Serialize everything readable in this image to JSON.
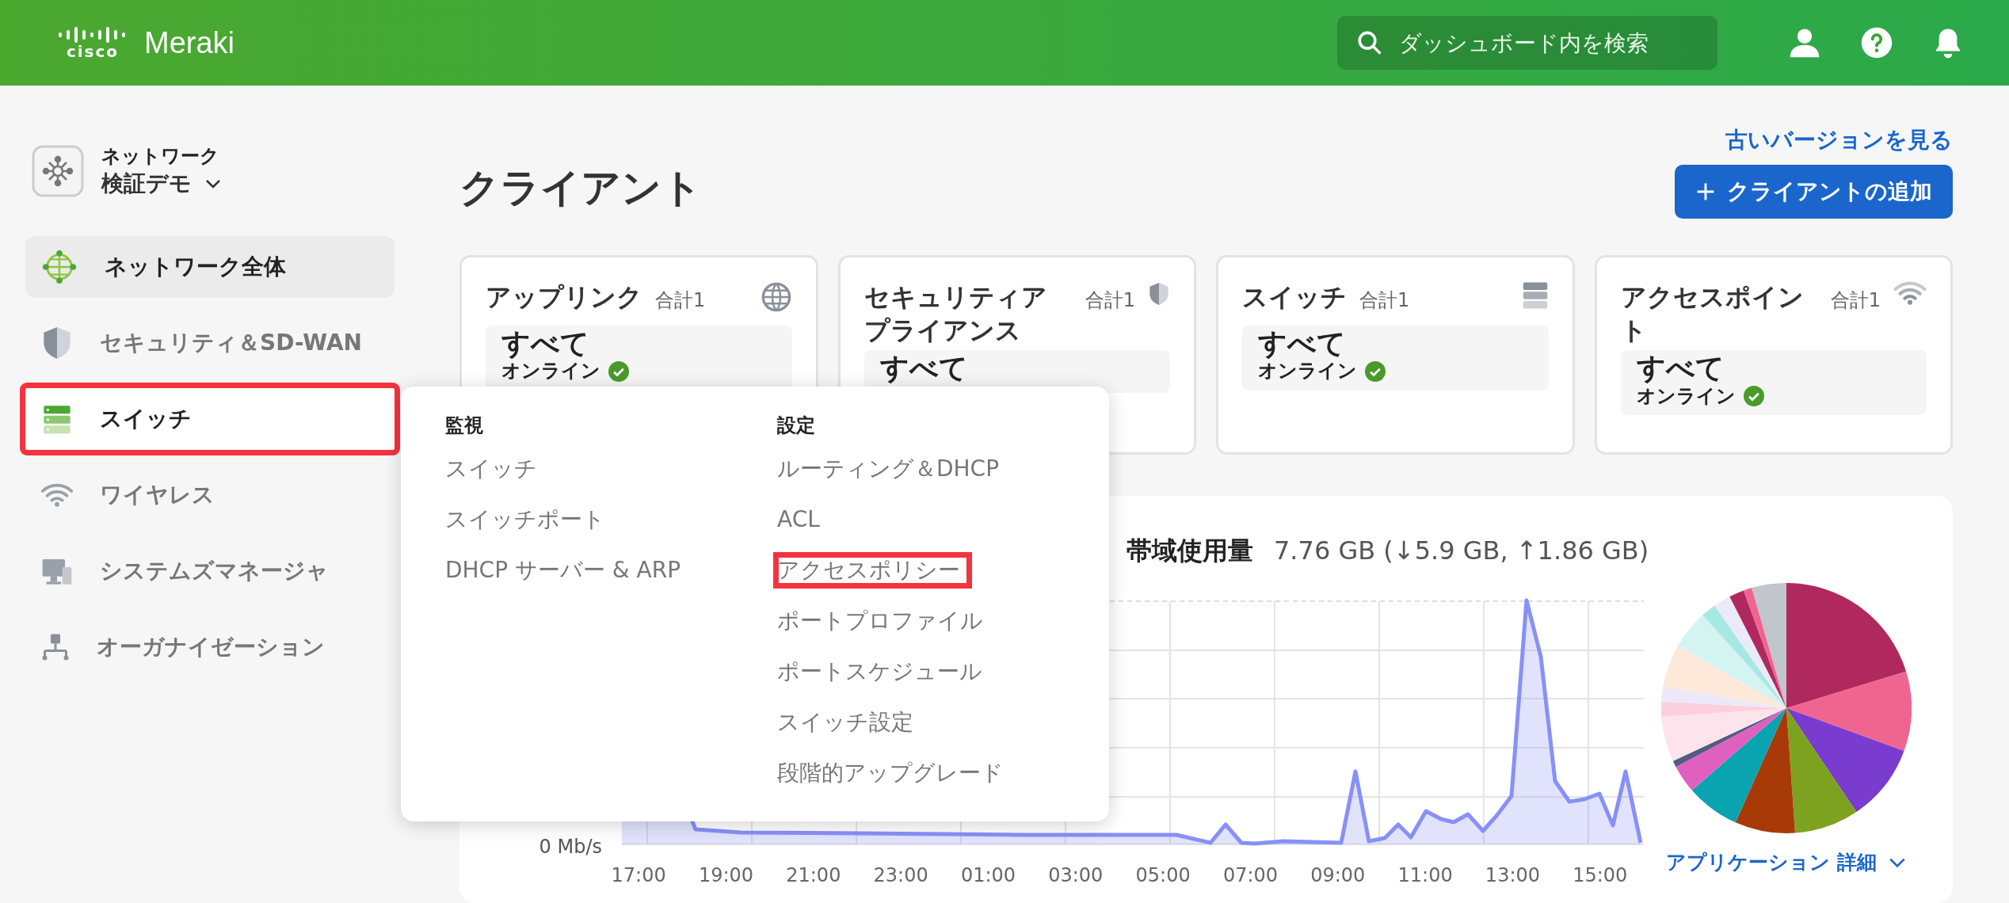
{
  "header": {
    "logo_text": "cisco",
    "product": "Meraki",
    "search": {
      "placeholder": "ダッシュボード内を検索"
    }
  },
  "sidebar": {
    "network": {
      "label": "ネットワーク",
      "name": "検証デモ"
    },
    "items": [
      {
        "label": "ネットワーク全体",
        "kind": "globe",
        "selected": true,
        "highlighted": false
      },
      {
        "label": "セキュリティ＆SD-WAN",
        "kind": "shield",
        "selected": false,
        "highlighted": false
      },
      {
        "label": "スイッチ",
        "kind": "switch",
        "selected": false,
        "highlighted": true
      },
      {
        "label": "ワイヤレス",
        "kind": "wifi",
        "selected": false,
        "highlighted": false
      },
      {
        "label": "システムズマネージャ",
        "kind": "monitor",
        "selected": false,
        "highlighted": false
      },
      {
        "label": "オーガナイゼーション",
        "kind": "org",
        "selected": false,
        "highlighted": false
      }
    ]
  },
  "page": {
    "title": "クライアント",
    "old_version_link": "古いバージョンを見る",
    "add_button": "クライアントの追加"
  },
  "cards": [
    {
      "title": "アップリンク",
      "total": "合計1",
      "kind": "globe",
      "value": "すべて",
      "status": {
        "label": "オンライン",
        "online": true
      }
    },
    {
      "title": "セキュリティアプライアンス",
      "total": "合計1",
      "kind": "shield",
      "value": "すべて"
    },
    {
      "title": "スイッチ",
      "total": "合計1",
      "kind": "server",
      "value": "すべて",
      "status": {
        "label": "オンライン",
        "online": true
      }
    },
    {
      "title": "アクセスポイント",
      "total": "合計1",
      "kind": "wifi",
      "value": "すべて",
      "status": {
        "label": "オンライン",
        "online": true
      }
    }
  ],
  "menu": {
    "columns": [
      {
        "heading": "監視",
        "items": [
          {
            "label": "スイッチ",
            "highlighted": false
          },
          {
            "label": "スイッチポート",
            "highlighted": false
          },
          {
            "label": "DHCP サーバー & ARP",
            "highlighted": false
          }
        ]
      },
      {
        "heading": "設定",
        "items": [
          {
            "label": "ルーティング＆DHCP",
            "highlighted": false
          },
          {
            "label": "ACL",
            "highlighted": false
          },
          {
            "label": "アクセスポリシー",
            "highlighted": true
          },
          {
            "label": "ポートプロファイル",
            "highlighted": false
          },
          {
            "label": "ポートスケジュール",
            "highlighted": false
          },
          {
            "label": "スイッチ設定",
            "highlighted": false
          },
          {
            "label": "段階的アップグレード",
            "highlighted": false
          }
        ]
      }
    ]
  },
  "usage": {
    "title": "帯域使用量",
    "summary": "7.76 GB (↓5.9 GB, ↑1.86 GB)",
    "y_label": "0 Mb/s",
    "x_labels": [
      "17:00",
      "19:00",
      "21:00",
      "23:00",
      "01:00",
      "03:00",
      "05:00",
      "07:00",
      "09:00",
      "11:00",
      "13:00",
      "15:00"
    ],
    "app_link": "アプリケーション 詳細"
  }
}
